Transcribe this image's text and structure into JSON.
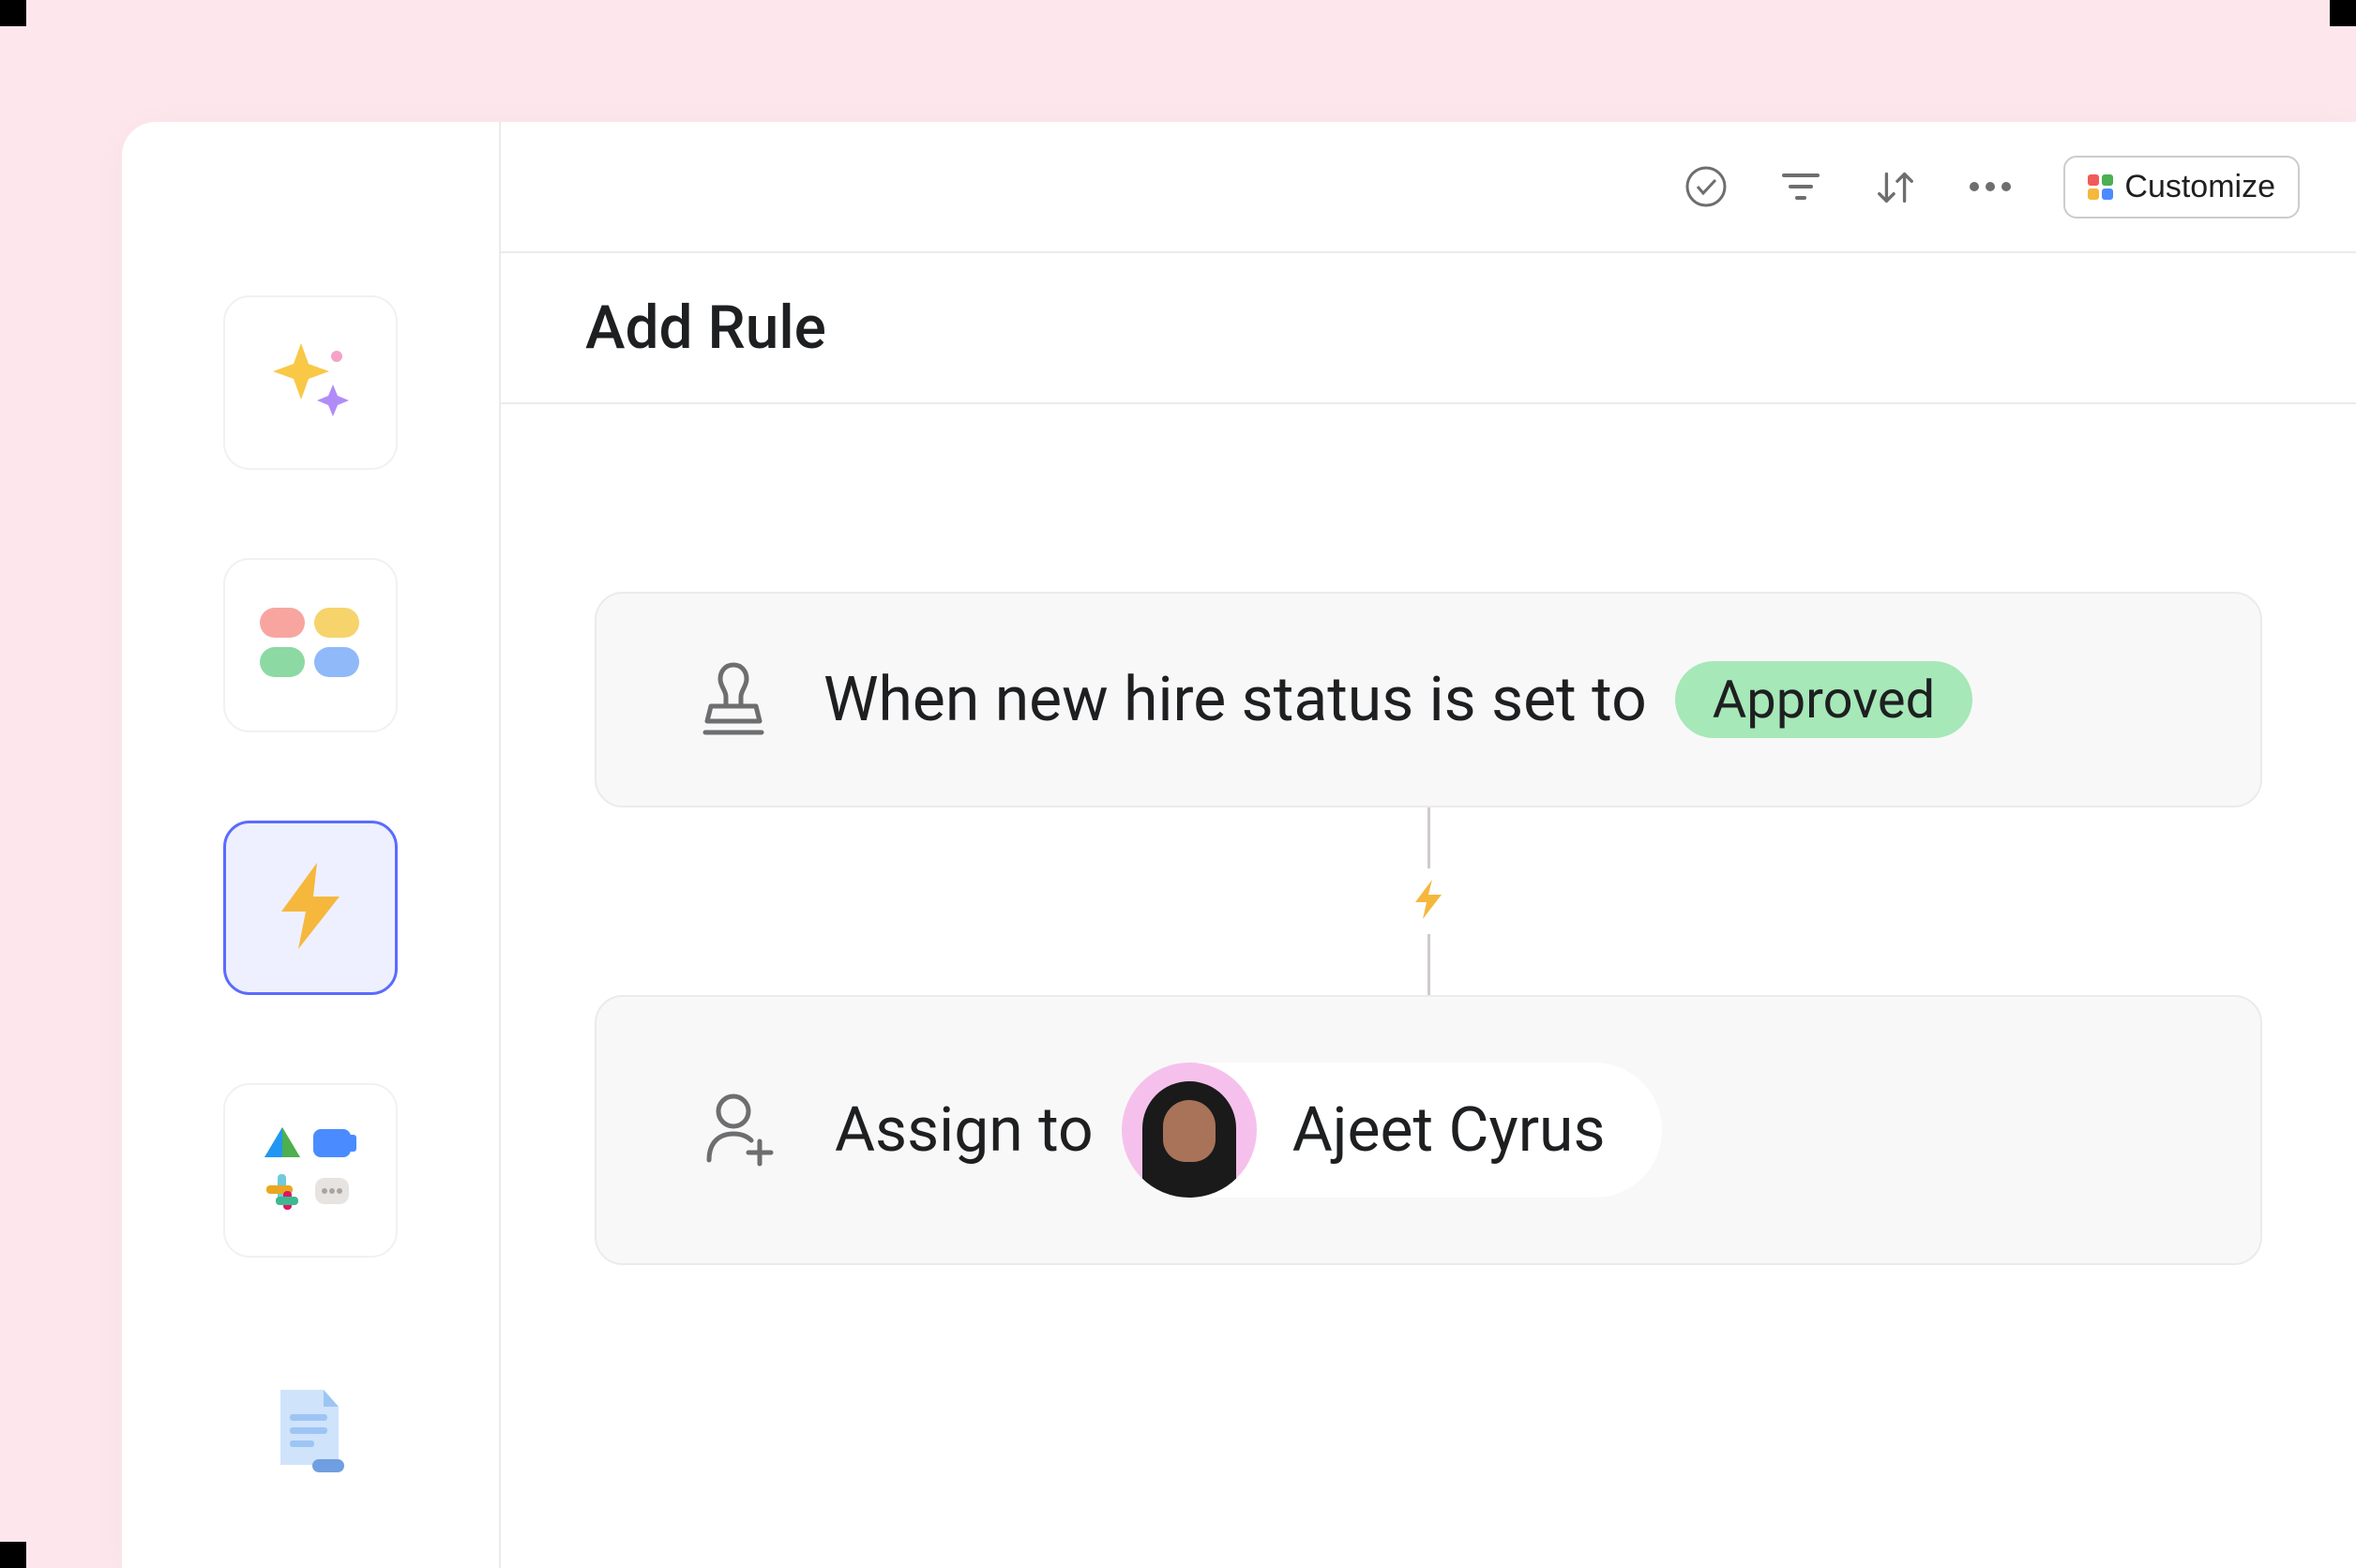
{
  "toolbar": {
    "customize_label": "Customize"
  },
  "header": {
    "title": "Add Rule"
  },
  "rule": {
    "trigger": {
      "text": "When new hire status is set to",
      "status_label": "Approved",
      "status_color": "#a6e8b8"
    },
    "action": {
      "label": "Assign to",
      "assignee_name": "Ajeet Cyrus"
    }
  },
  "sidebar": {
    "items": [
      {
        "name": "sparkles",
        "active": false
      },
      {
        "name": "status-dots",
        "active": false
      },
      {
        "name": "rules-bolt",
        "active": true
      },
      {
        "name": "apps-integrations",
        "active": false
      },
      {
        "name": "documents",
        "active": false
      }
    ]
  }
}
